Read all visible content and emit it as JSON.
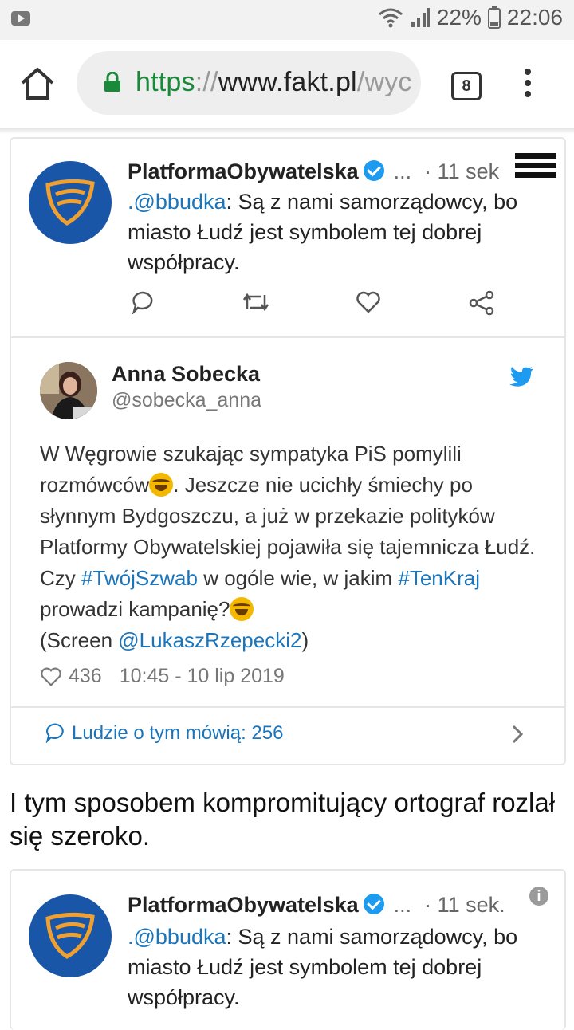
{
  "status_bar": {
    "battery_percent": "22%",
    "time": "22:06"
  },
  "browser": {
    "url_scheme": "https",
    "url_separator": "://",
    "url_host": "www.fakt.pl",
    "url_path": "/wyc",
    "tab_count": "8"
  },
  "tweet_top": {
    "author": "PlatformaObywatelska",
    "ellipsis": "...",
    "time": "· 11 sek",
    "mention": ".@bbudka",
    "text": ": Są z nami samorządowcy, bo miasto Łudź jest symbolem tej dobrej współpracy."
  },
  "tweet_main": {
    "name": "Anna Sobecka",
    "handle": "@sobecka_anna",
    "text_1": "W Węgrowie szukając sympatyka PiS pomylili rozmówców",
    "text_2": ". Jeszcze nie ucichły śmiechy po słynnym Bydgoszczu, a już w przekazie polityków Platformy Obywatelskiej pojawiła się tajemnicza Łudź. Czy ",
    "tag_1": "#TwójSzwab",
    "text_3": " w ogóle wie, w jakim ",
    "tag_2": "#TenKraj",
    "text_4": " prowadzi kampanię?",
    "text_5": "(Screen ",
    "mention": "@LukaszRzepecki2",
    "text_6": ")",
    "likes": "436",
    "date": "10:45 - 10 lip 2019",
    "talking": "Ludzie o tym mówią: 256"
  },
  "article": {
    "paragraph": "I tym sposobem kompromitujący ortograf rozlał się szeroko."
  },
  "tweet_bottom": {
    "author": "PlatformaObywatelska",
    "ellipsis": "...",
    "time": "· 11 sek.",
    "mention": ".@bbudka",
    "text": ": Są z nami samorządowcy, bo miasto Łudź jest symbolem tej dobrej współpracy."
  },
  "colors": {
    "link": "#1b75bb",
    "secure_green": "#1a8a3a",
    "po_blue": "#1a56a8",
    "po_orange": "#f0a030"
  }
}
